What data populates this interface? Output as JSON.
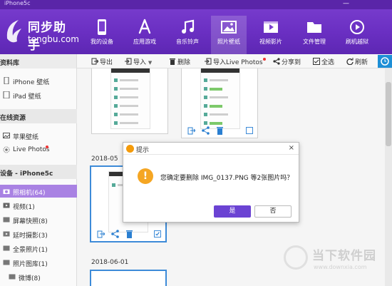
{
  "window": {
    "device_tab": "iPhone5c",
    "controls": "—"
  },
  "brand": {
    "name": "同步助手",
    "domain": "tongbu.com",
    "accent": "#6a2fc2"
  },
  "nav": {
    "items": [
      {
        "label": "我的设备",
        "icon": "phone-icon"
      },
      {
        "label": "应用游戏",
        "icon": "app-store-icon"
      },
      {
        "label": "音乐铃声",
        "icon": "music-icon"
      },
      {
        "label": "照片壁纸",
        "icon": "photo-icon"
      },
      {
        "label": "视频影片",
        "icon": "video-icon"
      },
      {
        "label": "文件管理",
        "icon": "folder-icon"
      },
      {
        "label": "刷机越狱",
        "icon": "flash-icon"
      }
    ],
    "active_index": 3
  },
  "toolbar": {
    "left_header": "资料库",
    "export": "导出",
    "import": "导入",
    "delete": "删除",
    "import_live": "导入Live Photos",
    "share": "分享到",
    "select_all": "全选",
    "refresh": "刷新"
  },
  "sidebar": {
    "items_top": [
      {
        "label": "iPhone 壁纸",
        "icon": "iphone-icon"
      },
      {
        "label": "iPad 壁纸",
        "icon": "ipad-icon"
      }
    ],
    "section_online": "在线资源",
    "items_online": [
      {
        "label": "苹果壁纸",
        "icon": "wallpaper-icon"
      },
      {
        "label": "Live Photos",
        "icon": "live-photo-icon"
      }
    ],
    "section_device": "设备 - iPhone5c",
    "items_device": [
      {
        "label": "照相机(64)",
        "icon": "camera-icon",
        "selected": true
      },
      {
        "label": "视频(1)",
        "icon": "video-small-icon"
      },
      {
        "label": "屏幕快照(8)",
        "icon": "screenshot-icon"
      },
      {
        "label": "延时摄影(3)",
        "icon": "timelapse-icon"
      },
      {
        "label": "全景照片(1)",
        "icon": "panorama-icon"
      },
      {
        "label": "照片图库(1)",
        "icon": "library-icon"
      }
    ],
    "sub_items": [
      {
        "label": "微博(8)",
        "icon": "album-icon"
      }
    ]
  },
  "content": {
    "dates": [
      "2018-05",
      "2018-06-01"
    ]
  },
  "dialog": {
    "title": "提示",
    "message": "您确定要删除 IMG_0137.PNG 等2张图片吗？",
    "yes": "是",
    "no": "否",
    "close": "×"
  },
  "watermark": {
    "text": "当下软件园",
    "url": "www.downxia.com"
  }
}
